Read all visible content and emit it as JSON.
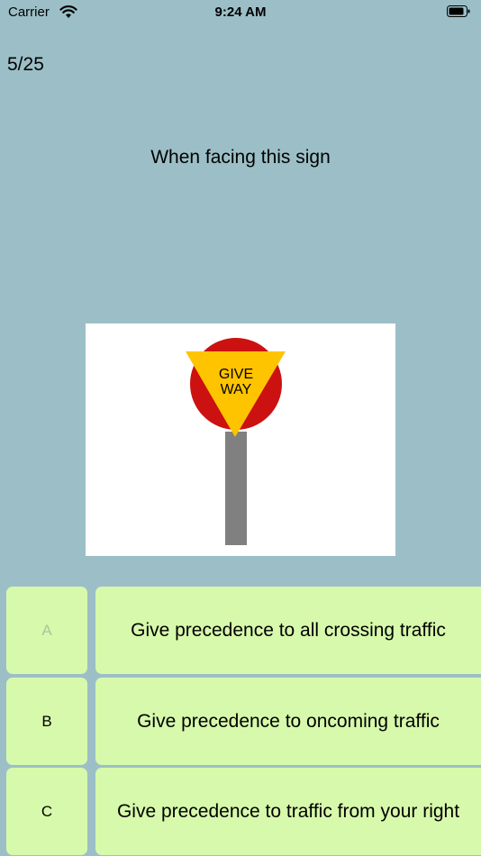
{
  "status_bar": {
    "carrier": "Carrier",
    "time": "9:24 AM",
    "icons": [
      "wifi-icon",
      "battery-icon"
    ]
  },
  "quiz": {
    "progress": "5/25",
    "question": "When facing this sign",
    "sign": {
      "text_line1": "GIVE",
      "text_line2": "WAY",
      "colors": {
        "circle": "#cc1111",
        "triangle": "#ffc400",
        "post": "#808080"
      }
    },
    "answers": [
      {
        "letter": "A",
        "text": "Give precedence to all crossing traffic"
      },
      {
        "letter": "B",
        "text": "Give precedence to oncoming traffic"
      },
      {
        "letter": "C",
        "text": "Give precedence to traffic from your right"
      }
    ]
  },
  "colors": {
    "background": "#9cbfc7",
    "answer_button": "#d7f9ab"
  }
}
